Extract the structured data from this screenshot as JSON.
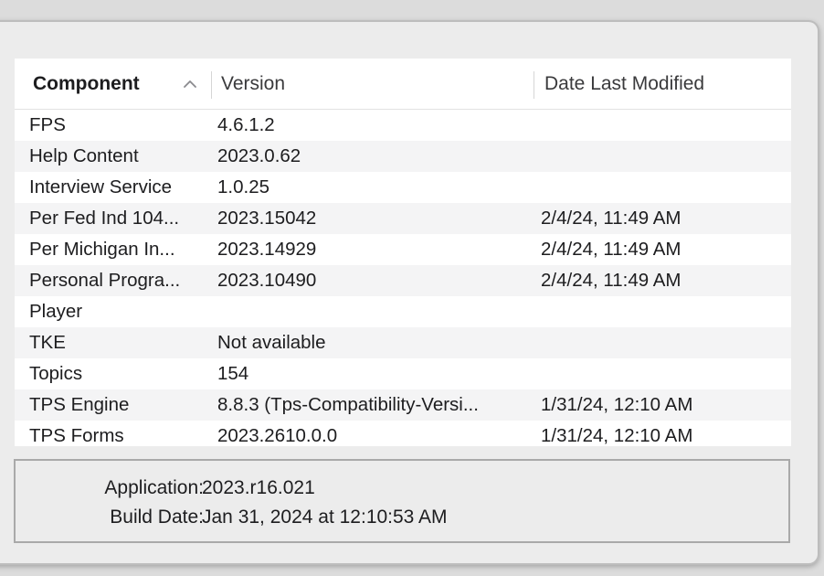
{
  "table": {
    "columns": [
      {
        "label": "Component",
        "sorted": "ascending"
      },
      {
        "label": "Version"
      },
      {
        "label": "Date Last Modified"
      }
    ],
    "rows": [
      {
        "component": "FPS",
        "version": "4.6.1.2",
        "date": ""
      },
      {
        "component": "Help Content",
        "version": "2023.0.62",
        "date": ""
      },
      {
        "component": "Interview Service",
        "version": "1.0.25",
        "date": ""
      },
      {
        "component": "Per Fed Ind 104...",
        "version": "2023.15042",
        "date": "2/4/24, 11:49 AM"
      },
      {
        "component": "Per Michigan In...",
        "version": "2023.14929",
        "date": "2/4/24, 11:49 AM"
      },
      {
        "component": "Personal Progra...",
        "version": "2023.10490",
        "date": "2/4/24, 11:49 AM"
      },
      {
        "component": "Player",
        "version": "",
        "date": ""
      },
      {
        "component": "TKE",
        "version": "Not available",
        "date": ""
      },
      {
        "component": "Topics",
        "version": "154",
        "date": ""
      },
      {
        "component": "TPS Engine",
        "version": "8.8.3 (Tps-Compatibility-Versi...",
        "date": "1/31/24, 12:10 AM"
      },
      {
        "component": "TPS Forms",
        "version": "2023.2610.0.0",
        "date": "1/31/24, 12:10 AM"
      }
    ]
  },
  "info": {
    "application_label": "Application:",
    "application_value": "2023.r16.021",
    "build_date_label": "Build Date:",
    "build_date_value": "Jan 31, 2024 at 12:10:53 AM"
  },
  "icons": {
    "sort": "chevron-up-icon"
  }
}
